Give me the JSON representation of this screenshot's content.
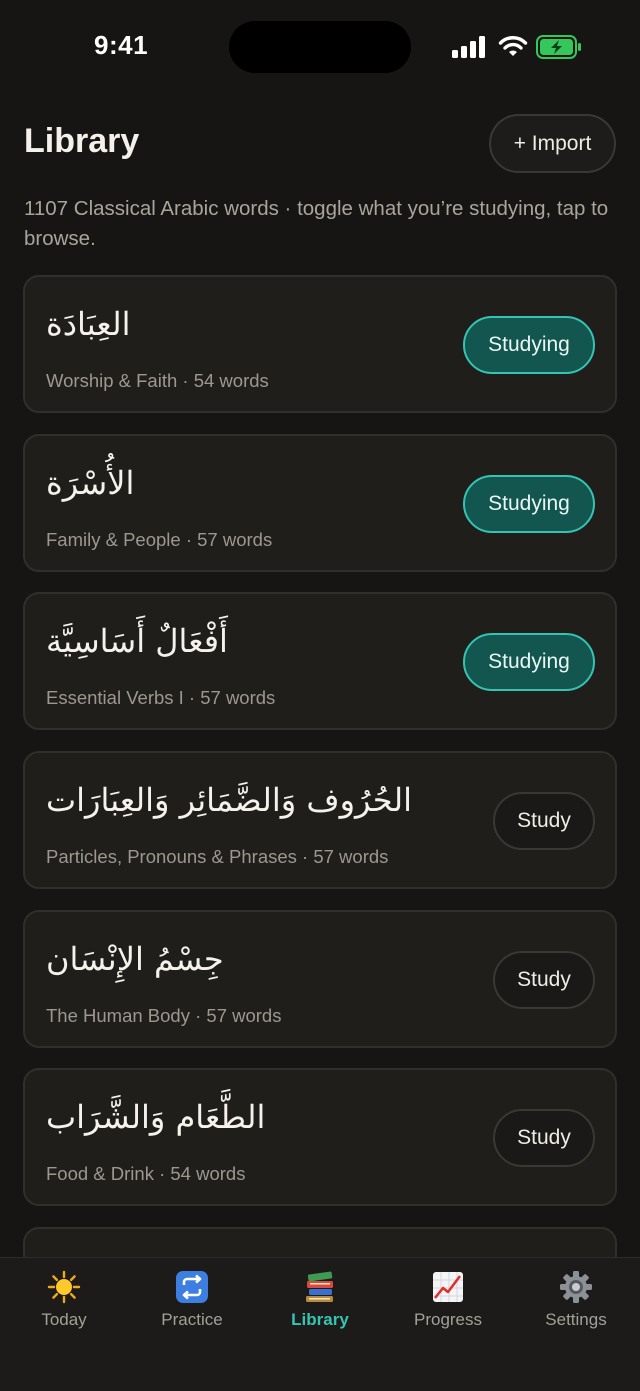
{
  "status_bar": {
    "time": "9:41"
  },
  "header": {
    "title": "Library",
    "import_label": "+ Import",
    "subtitle": "1107 Classical Arabic words · toggle what you’re studying, tap to browse."
  },
  "decks": [
    {
      "arabic": "العِبَادَة",
      "meta": "Worship & Faith · 54 words",
      "toggle": "Studying"
    },
    {
      "arabic": "الأُسْرَة",
      "meta": "Family & People · 57 words",
      "toggle": "Studying"
    },
    {
      "arabic": "أَفْعَالٌ أَسَاسِيَّة",
      "meta": "Essential Verbs I · 57 words",
      "toggle": "Studying"
    },
    {
      "arabic": "الحُرُوف وَالضَّمَائِر وَالعِبَارَات",
      "meta": "Particles, Pronouns & Phrases · 57 words",
      "toggle": "Study"
    },
    {
      "arabic": "جِسْمُ الإِنْسَان",
      "meta": "The Human Body · 57 words",
      "toggle": "Study"
    },
    {
      "arabic": "الطَّعَام وَالشَّرَاب",
      "meta": "Food & Drink · 54 words",
      "toggle": "Study"
    }
  ],
  "tabs": [
    {
      "label": "Today",
      "icon": "sun-icon"
    },
    {
      "label": "Practice",
      "icon": "repeat-icon"
    },
    {
      "label": "Library",
      "icon": "books-icon",
      "active": true
    },
    {
      "label": "Progress",
      "icon": "chart-icon"
    },
    {
      "label": "Settings",
      "icon": "gear-icon"
    }
  ],
  "colors": {
    "background": "#161513",
    "accent": "#35c4b2",
    "studying_fill": "#13554f",
    "battery": "#34c759"
  }
}
